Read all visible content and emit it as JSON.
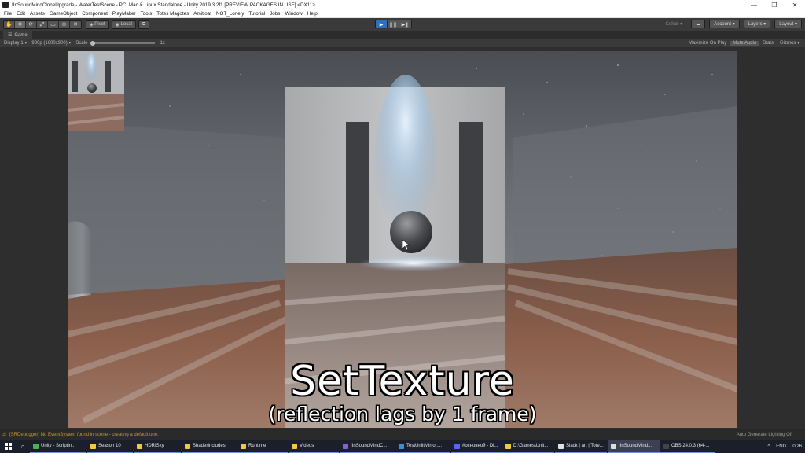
{
  "window": {
    "title": "!InSoundMindCloneUpgrade - WaterTestScene - PC, Mac & Linux Standalone - Unity 2019.3.2f1 [PREVIEW PACKAGES IN USE] <DX11>",
    "minimize": "—",
    "maximize": "❐",
    "close": "✕"
  },
  "menu": [
    "File",
    "Edit",
    "Assets",
    "GameObject",
    "Component",
    "PlayMaker",
    "Tools",
    "Totes Magotes",
    "Amitloaf",
    "NOT_Lonely",
    "Tutorial",
    "Jobs",
    "Window",
    "Help"
  ],
  "toolbar": {
    "pivot_label": "Pivot",
    "local_label": "Local",
    "collab_label": "Collab ▾",
    "account_label": "Account ▾",
    "layers_label": "Layers ▾",
    "layout_label": "Layout ▾"
  },
  "game_tab": {
    "label": "Game",
    "display": "Display 1 ▾",
    "resolution": "900p (1600x900) ▾",
    "scale_label": "Scale",
    "scale_value": "1x",
    "maximize_on_play": "Maximize On Play",
    "mute_audio": "Mute Audio",
    "stats": "Stats",
    "gizmos": "Gizmos ▾"
  },
  "scene": {
    "caption_main": "SetTexture",
    "caption_sub": "(reflection lags by 1 frame)"
  },
  "status": {
    "message": "[SRDebugger] No EventSystem found in scene - creating a default one.",
    "right": "Auto Generate Lighting Off"
  },
  "taskbar": {
    "tasks": [
      {
        "label": "Unity - Scriptin...",
        "color": "#4caf50",
        "active": false
      },
      {
        "label": "Season 10",
        "color": "#f2c744",
        "active": false
      },
      {
        "label": "HDRISky",
        "color": "#f2c744",
        "active": false
      },
      {
        "label": "ShaderIncludes",
        "color": "#f2c744",
        "active": false
      },
      {
        "label": "Runtime",
        "color": "#f2c744",
        "active": false
      },
      {
        "label": "Videos",
        "color": "#f2c744",
        "active": false
      },
      {
        "label": "!InSoundMindC...",
        "color": "#8a5cd6",
        "active": false
      },
      {
        "label": "TestUnlitMirror....",
        "color": "#3a8fd6",
        "active": false
      },
      {
        "label": "#основной - Di...",
        "color": "#5865f2",
        "active": false
      },
      {
        "label": "D:\\Games\\Unit...",
        "color": "#f2c744",
        "active": false
      },
      {
        "label": "Slack | art | Tote...",
        "color": "#e0e0e0",
        "active": false
      },
      {
        "label": "!InSoundMind...",
        "color": "#dddddd",
        "active": true
      },
      {
        "label": "OBS 24.0.3 (64-...",
        "color": "#444444",
        "active": false
      }
    ],
    "tray_chevron": "^",
    "language": "ENG",
    "time": "0:26"
  }
}
